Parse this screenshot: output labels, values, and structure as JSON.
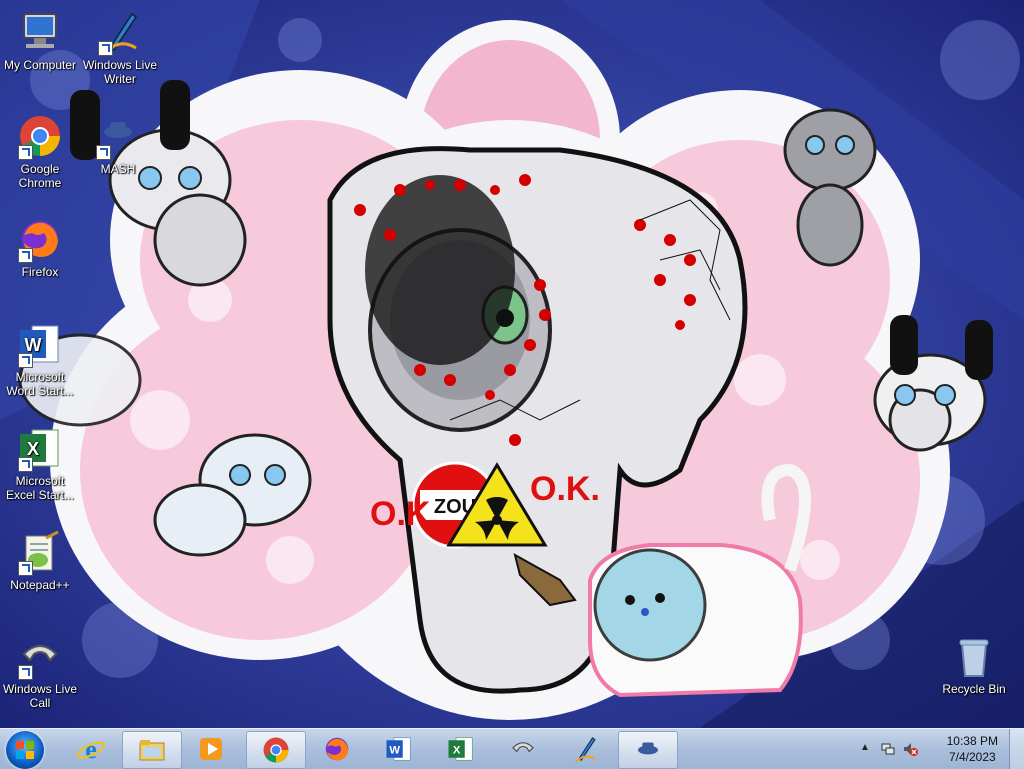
{
  "desktop_icons": [
    {
      "label": "My Computer",
      "icon": "computer-icon"
    },
    {
      "label": "Windows Live Writer",
      "icon": "live-writer-icon"
    },
    {
      "label": "Google Chrome",
      "icon": "chrome-icon"
    },
    {
      "label": "MASH",
      "icon": "mash-icon"
    },
    {
      "label": "Firefox",
      "icon": "firefox-icon"
    },
    {
      "label": "Microsoft Word Start...",
      "icon": "word-icon"
    },
    {
      "label": "Microsoft Excel Start...",
      "icon": "excel-icon"
    },
    {
      "label": "Notepad++",
      "icon": "notepadpp-icon"
    },
    {
      "label": "Windows Live Call",
      "icon": "phone-icon"
    },
    {
      "label": "Recycle Bin",
      "icon": "recycle-bin-icon"
    }
  ],
  "wallpaper": {
    "sign_text": "ZOU",
    "ok_text_1": "O.K.",
    "ok_text_2": "O.K.",
    "colors": {
      "blue": "#2a3a9e",
      "pink": "#f3b6cf",
      "red": "#e01010",
      "yellow": "#f4e21a"
    }
  },
  "taskbar": {
    "start_icon": "windows-logo-icon",
    "pinned": [
      {
        "name": "internet-explorer-icon",
        "active": false
      },
      {
        "name": "explorer-icon",
        "active": true
      },
      {
        "name": "media-player-icon",
        "active": false
      },
      {
        "name": "chrome-icon",
        "active": true
      },
      {
        "name": "firefox-icon",
        "active": false
      },
      {
        "name": "word-icon",
        "active": false
      },
      {
        "name": "excel-icon",
        "active": false
      },
      {
        "name": "phone-icon",
        "active": false
      },
      {
        "name": "live-writer-icon",
        "active": false
      },
      {
        "name": "mash-icon",
        "active": true
      }
    ],
    "tray": {
      "expand_arrow": "▲",
      "time": "10:38 PM",
      "date": "7/4/2023"
    }
  }
}
